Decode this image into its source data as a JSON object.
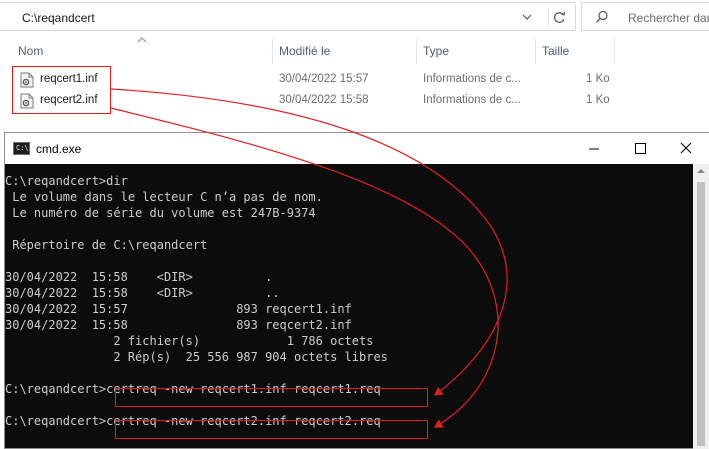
{
  "explorer": {
    "address": "C:\\reqandcert",
    "search_placeholder": "Rechercher dans",
    "columns": {
      "name": "Nom",
      "modified": "Modifié le",
      "type": "Type",
      "size": "Taille"
    },
    "files": [
      {
        "name": "reqcert1.inf",
        "modified": "30/04/2022 15:57",
        "type": "Informations de c...",
        "size": "1 Ko"
      },
      {
        "name": "reqcert2.inf",
        "modified": "30/04/2022 15:58",
        "type": "Informations de c...",
        "size": "1 Ko"
      }
    ]
  },
  "cmd": {
    "title": "cmd.exe",
    "icon_text": "C:\\",
    "lines": [
      "",
      "C:\\reqandcert>dir",
      " Le volume dans le lecteur C n’a pas de nom.",
      " Le numéro de série du volume est 247B-9374",
      "",
      " Répertoire de C:\\reqandcert",
      "",
      "30/04/2022  15:58    <DIR>          .",
      "30/04/2022  15:58    <DIR>          ..",
      "30/04/2022  15:57               893 reqcert1.inf",
      "30/04/2022  15:58               893 reqcert2.inf",
      "               2 fichier(s)            1 786 octets",
      "               2 Rép(s)  25 556 987 904 octets libres",
      "",
      "C:\\reqandcert>certreq -new reqcert1.inf reqcert1.req",
      "",
      "C:\\reqandcert>certreq -new reqcert2.inf reqcert2.req"
    ]
  },
  "colors": {
    "annotation": "#e02020",
    "console_bg": "#0c0c0c",
    "console_fg": "#cccccc"
  }
}
